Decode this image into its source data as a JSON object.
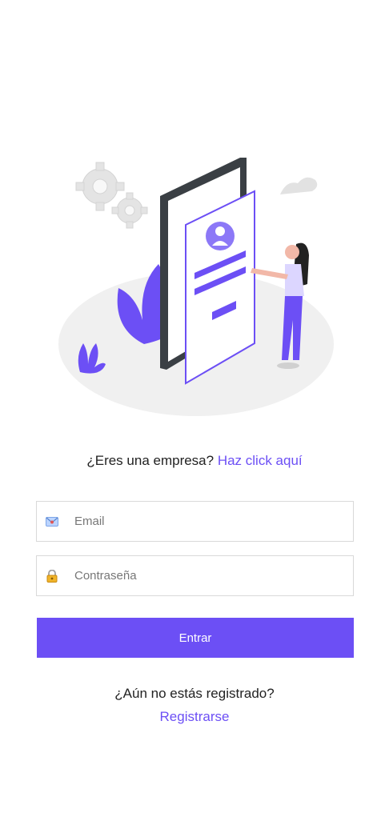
{
  "company_prompt": {
    "question": "¿Eres una empresa?",
    "link": "Haz click aquí"
  },
  "email_field": {
    "placeholder": "Email",
    "value": "",
    "icon": "envelope-icon"
  },
  "password_field": {
    "placeholder": "Contraseña",
    "value": "",
    "icon": "lock-icon"
  },
  "submit": {
    "label": "Entrar"
  },
  "register": {
    "question": "¿Aún no estás registrado?",
    "link": "Registrarse"
  },
  "colors": {
    "accent": "#6c4ff5",
    "phone": "#3a3f44",
    "gear": "#e6e6e6"
  }
}
